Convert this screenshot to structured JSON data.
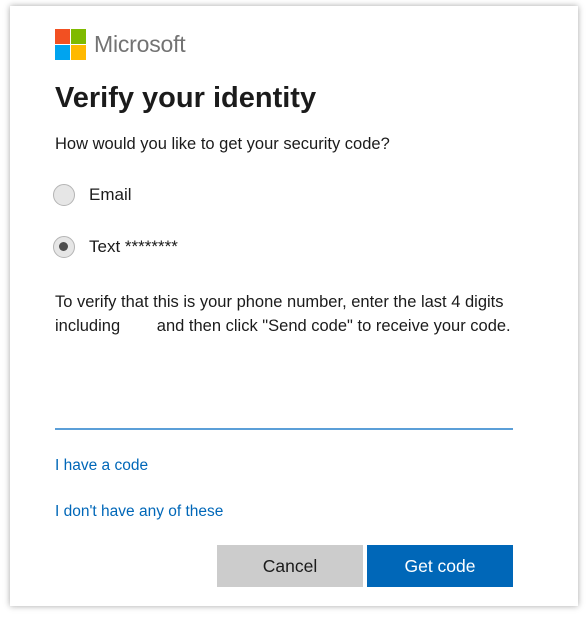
{
  "brand": {
    "name": "Microsoft",
    "logo_colors": [
      "#f25022",
      "#7fba00",
      "#00a4ef",
      "#ffb900"
    ]
  },
  "title": "Verify your identity",
  "subtitle": "How would you like to get your security code?",
  "options": [
    {
      "label": "Email",
      "selected": false
    },
    {
      "label": "Text ********",
      "selected": true
    }
  ],
  "instructions": "To verify that this is your phone number, enter the last 4 digits including        and then click \"Send code\" to receive your code.",
  "digits_input": {
    "value": "",
    "placeholder": ""
  },
  "links": {
    "have_code": "I have a code",
    "dont_have": "I don't have any of these"
  },
  "buttons": {
    "cancel": "Cancel",
    "get_code": "Get code"
  },
  "colors": {
    "accent": "#0067b8",
    "input_underline": "#5b9fd8",
    "secondary_button": "#cccccc"
  }
}
